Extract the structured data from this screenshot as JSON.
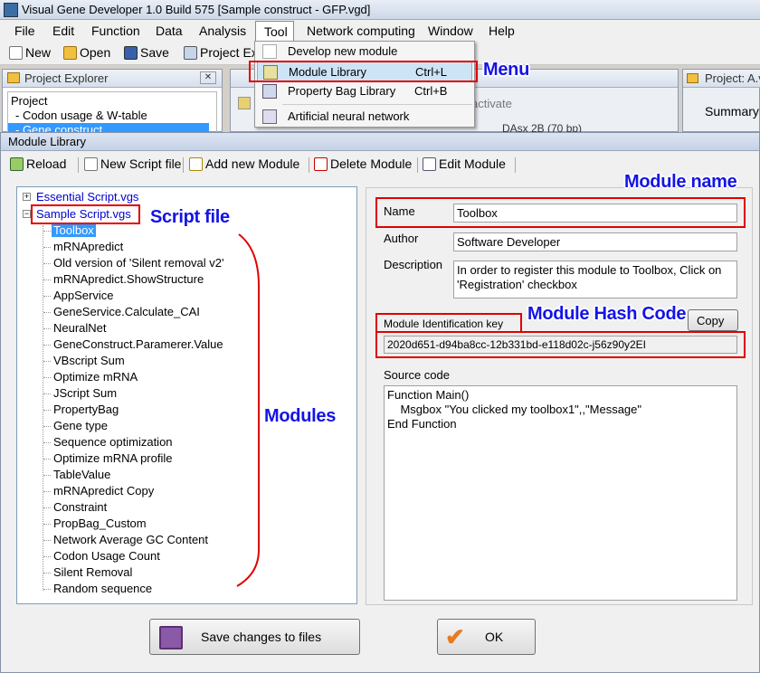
{
  "window": {
    "title": "Visual Gene Developer 1.0 Build 575    [Sample construct - GFP.vgd]"
  },
  "menubar": [
    "File",
    "Edit",
    "Function",
    "Data",
    "Analysis",
    "Tool",
    "Network computing",
    "Window",
    "Help"
  ],
  "toolbar": {
    "new_label": "New",
    "open_label": "Open",
    "save_label": "Save",
    "project_explorer_label": "Project Ex"
  },
  "project_explorer": {
    "title": "Project Explorer",
    "items": [
      "Project",
      "- Codon usage & W-table",
      "- Gene construct"
    ]
  },
  "middle_panel": {
    "tab_text": "activate",
    "row_text": "DAsx 2B (70 bp)"
  },
  "right_panel": {
    "title": "Project:  A.v",
    "tab": "Summary"
  },
  "tool_menu": {
    "items": [
      {
        "label": "Develop new module",
        "shortcut": "",
        "icon": "develop-icon"
      },
      {
        "label": "Module Library",
        "shortcut": "Ctrl+L",
        "icon": "library-icon"
      },
      {
        "label": "Property Bag Library",
        "shortcut": "Ctrl+B",
        "icon": "propertybag-icon"
      },
      {
        "label": "Artificial neural network",
        "shortcut": "",
        "icon": "neural-network-icon"
      }
    ]
  },
  "module_library": {
    "title": "Module Library",
    "toolbar": {
      "reload": "Reload",
      "new_script": "New Script file",
      "add_module": "Add new Module",
      "delete_module": "Delete Module",
      "edit_module": "Edit Module"
    },
    "tree": {
      "root1": "Essential Script.vgs",
      "root2": "Sample Script.vgs",
      "modules": [
        "Toolbox",
        "mRNApredict",
        "Old version of 'Silent removal v2'",
        "mRNApredict.ShowStructure",
        "AppService",
        "GeneService.Calculate_CAI",
        "NeuralNet",
        "GeneConstruct.Paramerer.Value",
        "VBscript Sum",
        "Optimize mRNA",
        "JScript Sum",
        "PropertyBag",
        "Gene type",
        "Sequence optimization",
        "Optimize mRNA profile",
        "TableValue",
        "mRNApredict Copy",
        "Constraint",
        "PropBag_Custom",
        "Network Average GC Content",
        "Codon Usage Count",
        "Silent Removal",
        "Random sequence"
      ]
    },
    "props": {
      "name_label": "Name",
      "name_value": "Toolbox",
      "author_label": "Author",
      "author_value": "Software Developer",
      "description_label": "Description",
      "description_value": "In order to register this module to Toolbox, Click on 'Registration' checkbox",
      "key_label": "Module Identification key",
      "copy_label": "Copy",
      "key_value": "2020d651-d94ba8cc-12b331bd-e118d02c-j56z90y2EI",
      "source_label": "Source code",
      "source_lines": [
        "Function Main()",
        "    Msgbox \"You clicked my toolbox1\",,\"Message\"",
        "End Function"
      ]
    },
    "save_button": "Save changes to files",
    "ok_button": "OK"
  },
  "annotations": {
    "menu": "Menu",
    "module_name": "Module name",
    "script_file": "Script file",
    "module_hash": "Module Hash Code",
    "modules": "Modules"
  },
  "colors": {
    "annotation_text": "#1414e6",
    "highlight_box": "#e00000",
    "selection": "#3399ff",
    "link_blue": "#0000cc"
  }
}
